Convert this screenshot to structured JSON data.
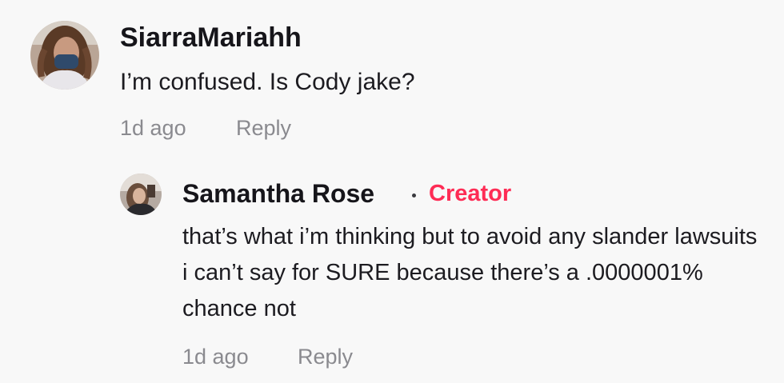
{
  "comments": [
    {
      "username": "SiarraMariahh",
      "text": "I’m confused. Is Cody jake?",
      "time": "1d ago",
      "reply_label": "Reply"
    }
  ],
  "reply": {
    "username": "Samantha Rose",
    "badge": "Creator",
    "text": "that’s what i’m thinking but to avoid any slander lawsuits i can’t say for SURE because there’s a .0000001% chance not",
    "time": "1d ago",
    "reply_label": "Reply"
  },
  "colors": {
    "background": "#f8f8f8",
    "creator_badge": "#fe2c55",
    "meta_text": "#8a8a8f",
    "username_text": "#16151a"
  }
}
